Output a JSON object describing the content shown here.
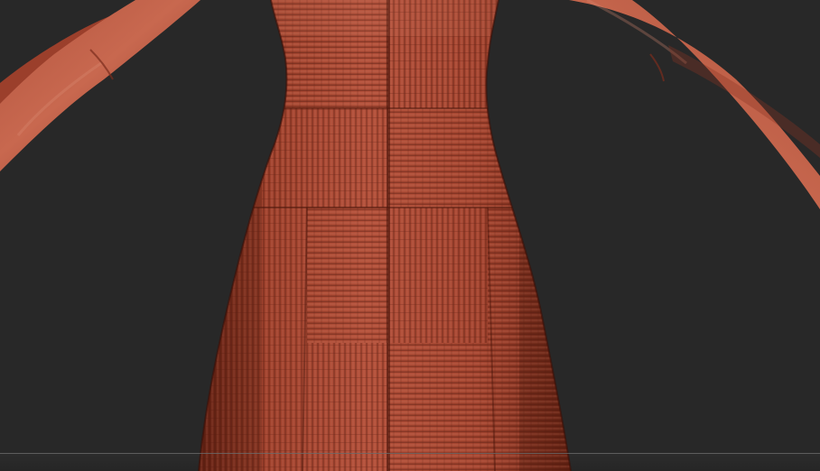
{
  "viewport": {
    "background_color": "#282828",
    "model_color": "#a5442f",
    "highlight_color": "#c96b55",
    "shadow_color": "#5a1e12"
  },
  "model": {
    "parts": [
      "left-arm",
      "right-arm",
      "dress-bodice",
      "dress-skirt"
    ],
    "surface_detail": "woven-basketweave-pattern"
  }
}
